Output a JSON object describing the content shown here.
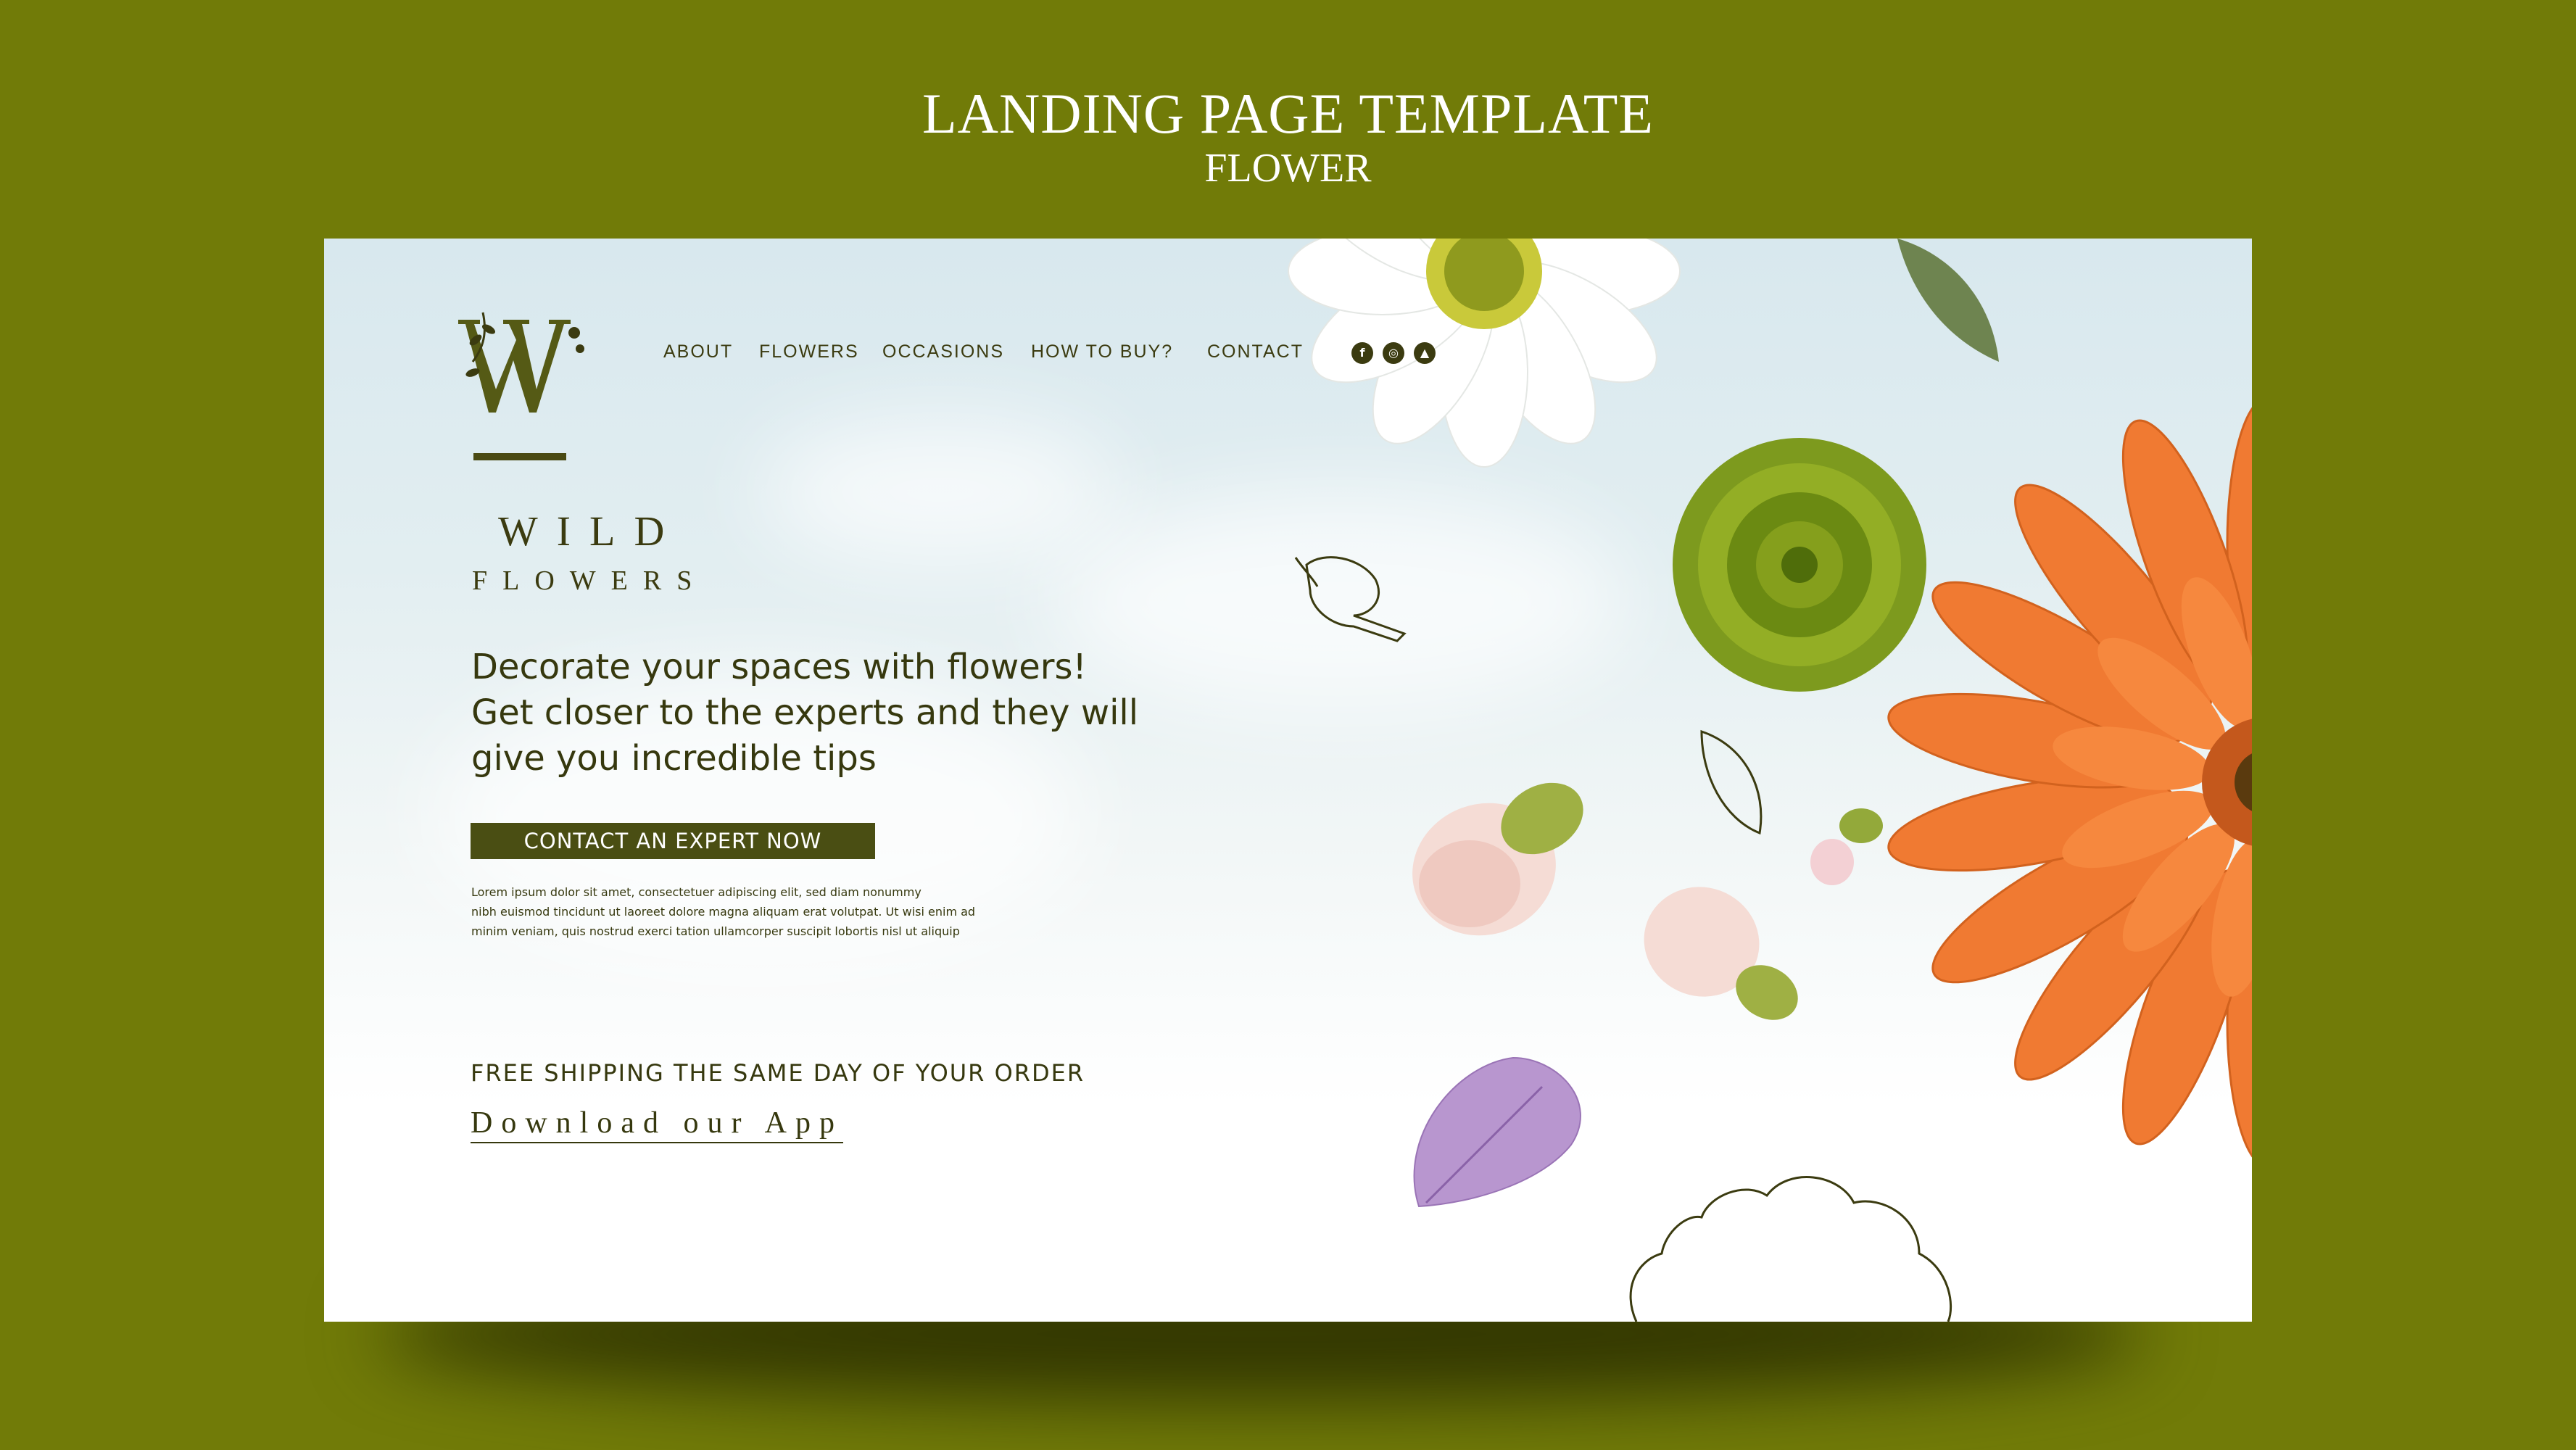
{
  "header": {
    "title": "LANDING PAGE TEMPLATE",
    "subtitle": "FLOWER"
  },
  "site": {
    "logo_letter": "W",
    "brand_line1": "WILD",
    "brand_line2": "FLOWERS",
    "nav": [
      {
        "label": "ABOUT"
      },
      {
        "label": "FLOWERS"
      },
      {
        "label": "OCCASIONS"
      },
      {
        "label": "HOW TO BUY?"
      },
      {
        "label": "CONTACT"
      }
    ],
    "social": [
      {
        "icon": "facebook-icon",
        "glyph": "f"
      },
      {
        "icon": "instagram-icon",
        "glyph": "◎"
      },
      {
        "icon": "twitter-icon",
        "glyph": "🐦"
      }
    ],
    "headline": [
      "Decorate your spaces with flowers!",
      "Get closer to the experts and they will",
      "give you incredible tips"
    ],
    "cta_label": "CONTACT AN EXPERT NOW",
    "lorem": [
      "Lorem ipsum dolor sit amet, consectetuer adipiscing elit, sed diam nonummy",
      "nibh euismod tincidunt ut  laoreet dolore magna aliquam erat volutpat. Ut wisi enim ad",
      "minim veniam, quis nostrud exerci tation ullamcorper suscipit lobortis nisl ut aliquip"
    ],
    "shipping": "FREE SHIPPING THE SAME DAY OF YOUR ORDER",
    "app_link": "Download our App"
  },
  "colors": {
    "background": "#717b08",
    "text_dark": "#36380e",
    "button": "#4a4e13"
  }
}
